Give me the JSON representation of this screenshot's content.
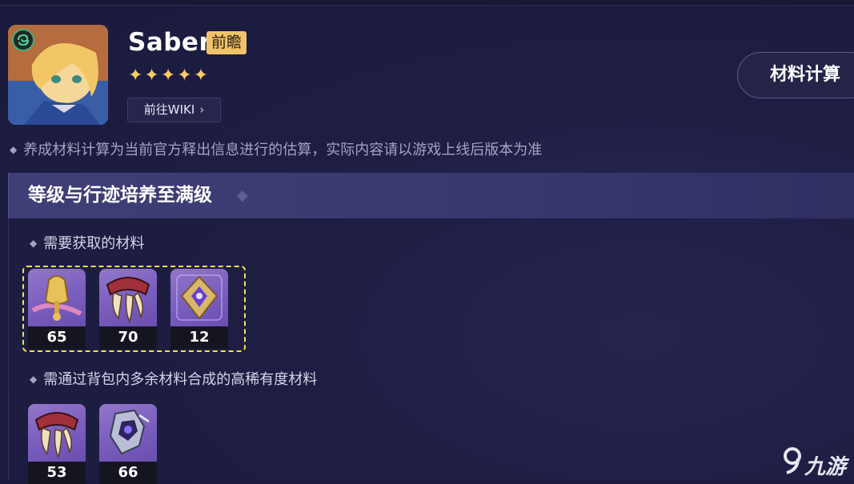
{
  "header": {
    "character_name": "Saber",
    "badge": "前瞻",
    "stars": "✦✦✦✦✦",
    "wiki_label": "前往WIKI",
    "calc_button": "材料计算"
  },
  "notice": "养成材料计算为当前官方释出信息进行的估算，实际内容请以游戏上线后版本为准",
  "section": {
    "title": "等级与行迹培养至满级",
    "required_label": "需要获取的材料",
    "required_items": [
      {
        "icon": "bell-relic-icon",
        "count": "65"
      },
      {
        "icon": "claw-relic-icon",
        "count": "70"
      },
      {
        "icon": "crystal-relic-icon",
        "count": "12"
      }
    ],
    "synth_label": "需通过背包内多余材料合成的高稀有度材料",
    "synth_items": [
      {
        "icon": "claw-relic-icon",
        "count": "53"
      },
      {
        "icon": "mecha-relic-icon",
        "count": "66"
      }
    ]
  },
  "watermark": "九游",
  "colors": {
    "badge": "#f0c36a",
    "stars": "#f6cc65",
    "highlight_dash": "#f2e24a",
    "item_frame": "#7b5fbf"
  }
}
